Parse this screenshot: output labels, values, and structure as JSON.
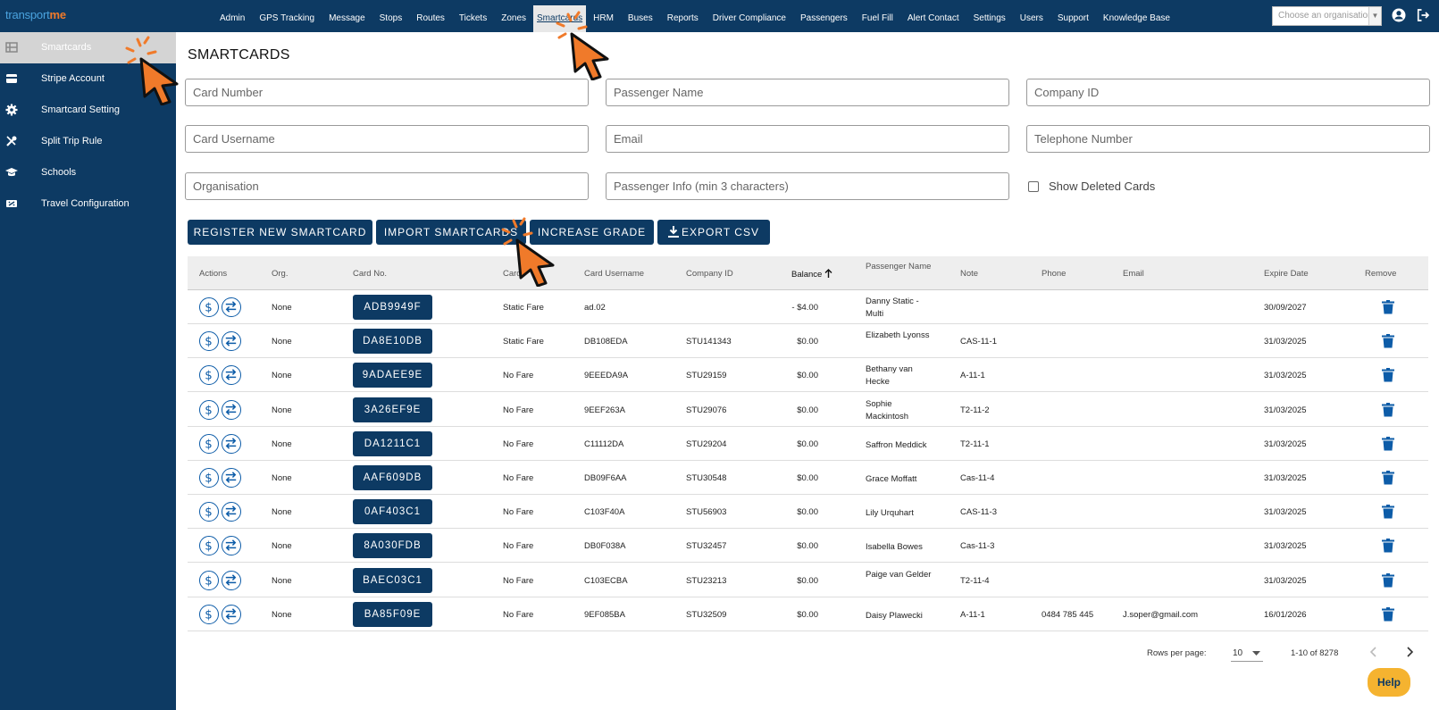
{
  "brand": {
    "part1": "transport",
    "part2": "me"
  },
  "nav": [
    "Admin",
    "GPS Tracking",
    "Message",
    "Stops",
    "Routes",
    "Tickets",
    "Zones",
    "Smartcards",
    "HRM",
    "Buses",
    "Reports",
    "Driver Compliance",
    "Passengers",
    "Fuel Fill",
    "Alert Contact",
    "Settings",
    "Users",
    "Support",
    "Knowledge Base"
  ],
  "nav_active": "Smartcards",
  "org_select": {
    "placeholder": "Choose an organisation"
  },
  "sidebar": [
    {
      "label": "Smartcards",
      "icon": "grid-icon"
    },
    {
      "label": "Stripe Account",
      "icon": "card-icon"
    },
    {
      "label": "Smartcard Setting",
      "icon": "gear-icon"
    },
    {
      "label": "Split Trip Rule",
      "icon": "tools-icon"
    },
    {
      "label": "Schools",
      "icon": "school-icon"
    },
    {
      "label": "Travel Configuration",
      "icon": "ticket-icon"
    }
  ],
  "page_title": "SMARTCARDS",
  "filters": {
    "card_number": "Card Number",
    "passenger_name": "Passenger Name",
    "company_id": "Company ID",
    "card_username": "Card Username",
    "email": "Email",
    "telephone": "Telephone Number",
    "organisation": "Organisation",
    "passenger_info": "Passenger Info (min 3 characters)",
    "show_deleted": "Show Deleted Cards"
  },
  "buttons": {
    "register": "REGISTER NEW SMARTCARD",
    "import": "IMPORT SMARTCARDS",
    "increase": "INCREASE GRADE",
    "export": "EXPORT CSV"
  },
  "table": {
    "headers": {
      "actions": "Actions",
      "org": "Org.",
      "card_no": "Card No.",
      "card_type": "Card",
      "card_username": "Card Username",
      "company_id": "Company ID",
      "balance": "Balance",
      "passenger_name": "Passenger Name",
      "note": "Note",
      "phone": "Phone",
      "email": "Email",
      "expire": "Expire Date",
      "remove": "Remove"
    },
    "rows": [
      {
        "org": "None",
        "card_no": "ADB9949F",
        "type": "Static Fare",
        "username": "ad.02",
        "company_id": "",
        "balance": "- $4.00",
        "passenger": "Danny Static - Multi",
        "note": "",
        "phone": "",
        "email": "",
        "expire": "30/09/2027"
      },
      {
        "org": "None",
        "card_no": "DA8E10DB",
        "type": "Static Fare",
        "username": "DB108EDA",
        "company_id": "STU141343",
        "balance": "$0.00",
        "passenger": "Elizabeth Lyonss",
        "note": "CAS-11-1",
        "phone": "",
        "email": "",
        "expire": "31/03/2025"
      },
      {
        "org": "None",
        "card_no": "9ADAEE9E",
        "type": "No Fare",
        "username": "9EEEDA9A",
        "company_id": "STU29159",
        "balance": "$0.00",
        "passenger": "Bethany van Hecke",
        "note": "A-11-1",
        "phone": "",
        "email": "",
        "expire": "31/03/2025"
      },
      {
        "org": "None",
        "card_no": "3A26EF9E",
        "type": "No Fare",
        "username": "9EEF263A",
        "company_id": "STU29076",
        "balance": "$0.00",
        "passenger": "Sophie Mackintosh",
        "note": "T2-11-2",
        "phone": "",
        "email": "",
        "expire": "31/03/2025"
      },
      {
        "org": "None",
        "card_no": "DA1211C1",
        "type": "No Fare",
        "username": "C11112DA",
        "company_id": "STU29204",
        "balance": "$0.00",
        "passenger": "Saffron Meddick",
        "note": "T2-11-1",
        "phone": "",
        "email": "",
        "expire": "31/03/2025"
      },
      {
        "org": "None",
        "card_no": "AAF609DB",
        "type": "No Fare",
        "username": "DB09F6AA",
        "company_id": "STU30548",
        "balance": "$0.00",
        "passenger": "Grace Moffatt",
        "note": "Cas-11-4",
        "phone": "",
        "email": "",
        "expire": "31/03/2025"
      },
      {
        "org": "None",
        "card_no": "0AF403C1",
        "type": "No Fare",
        "username": "C103F40A",
        "company_id": "STU56903",
        "balance": "$0.00",
        "passenger": "Lily Urquhart",
        "note": "CAS-11-3",
        "phone": "",
        "email": "",
        "expire": "31/03/2025"
      },
      {
        "org": "None",
        "card_no": "8A030FDB",
        "type": "No Fare",
        "username": "DB0F038A",
        "company_id": "STU32457",
        "balance": "$0.00",
        "passenger": "Isabella Bowes",
        "note": "Cas-11-3",
        "phone": "",
        "email": "",
        "expire": "31/03/2025"
      },
      {
        "org": "None",
        "card_no": "BAEC03C1",
        "type": "No Fare",
        "username": "C103ECBA",
        "company_id": "STU23213",
        "balance": "$0.00",
        "passenger": "Paige van Gelder",
        "note": "T2-11-4",
        "phone": "",
        "email": "",
        "expire": "31/03/2025"
      },
      {
        "org": "None",
        "card_no": "BA85F09E",
        "type": "No Fare",
        "username": "9EF085BA",
        "company_id": "STU32509",
        "balance": "$0.00",
        "passenger": "Daisy Plawecki",
        "note": "A-11-1",
        "phone": "0484 785 445",
        "email": "J.soper@gmail.com",
        "expire": "16/01/2026"
      }
    ]
  },
  "footer": {
    "rows_per_page_label": "Rows per page:",
    "rows_per_page": "10",
    "range": "1-10 of 8278"
  },
  "help": "Help",
  "colors": {
    "navy": "#0d3a63",
    "accent_orange": "#f07a2a",
    "help_yellow": "#f5b330"
  }
}
